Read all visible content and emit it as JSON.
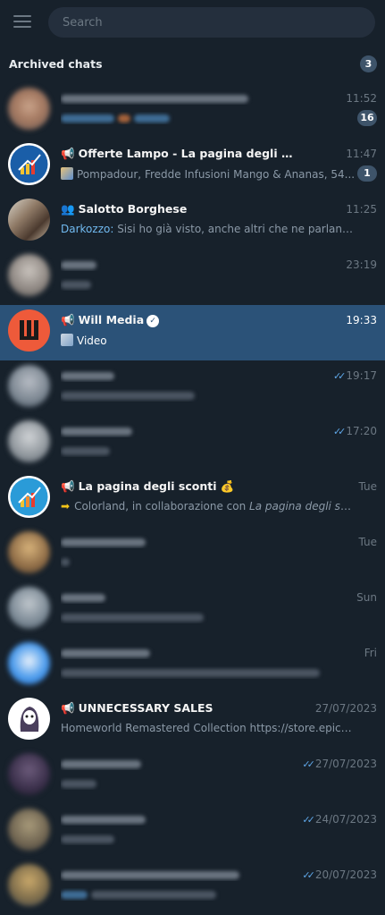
{
  "search": {
    "placeholder": "Search"
  },
  "archive": {
    "title": "Archived chats",
    "count": "3"
  },
  "chats": [
    {
      "time": "11:52",
      "unread": "16"
    },
    {
      "name": "Offerte Lampo - La pagina degli sconti",
      "time": "11:47",
      "preview": "Pompadour, Fredde Infusioni Mango & Ananas, 54...",
      "unread": "1"
    },
    {
      "name": "Salotto Borghese",
      "time": "11:25",
      "sender": "Darkozzo:",
      "preview": " Sisi ho già visto, anche altri che ne parlano. Son..."
    },
    {
      "time": "23:19"
    },
    {
      "name": "Will Media",
      "time": "19:33",
      "preview": "Video"
    },
    {
      "time": "19:17"
    },
    {
      "time": "17:20"
    },
    {
      "name": "La pagina degli sconti 💰",
      "time": "Tue",
      "preview": "Colorland, in collaborazione con ",
      "preview_italic": "La pagina degli sconti",
      "preview_end": ", ..."
    },
    {
      "time": "Tue"
    },
    {
      "time": "Sun"
    },
    {
      "time": "Fri"
    },
    {
      "name": "UNNECESSARY SALES",
      "time": "27/07/2023",
      "preview": "Homeworld Remastered Collection https://store.epicgam..."
    },
    {
      "time": "27/07/2023"
    },
    {
      "time": "24/07/2023"
    },
    {
      "time": "20/07/2023"
    }
  ],
  "colors": {
    "background": "#17212b",
    "selected": "#2b5278",
    "accent": "#71baf0",
    "badge": "#3e546a"
  }
}
